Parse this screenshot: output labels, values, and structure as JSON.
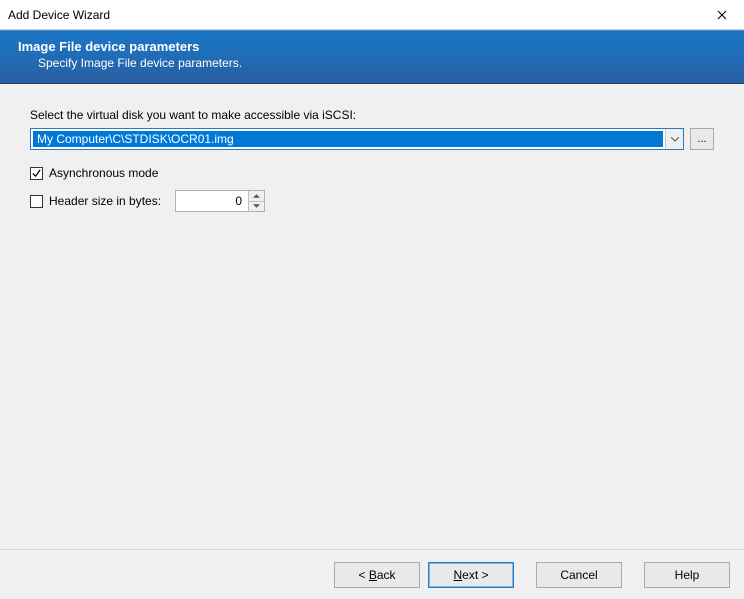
{
  "window": {
    "title": "Add Device Wizard"
  },
  "banner": {
    "heading": "Image File device parameters",
    "subheading": "Specify Image File device parameters."
  },
  "main": {
    "select_label": "Select the virtual disk you want to make accessible via iSCSI:",
    "disk_path": "My Computer\\C\\STDISK\\OCR01.img",
    "browse_label": "...",
    "async_checked": true,
    "async_label": "Asynchronous mode",
    "header_checked": false,
    "header_label": "Header size in bytes:",
    "header_value": "0"
  },
  "footer": {
    "back_pre": "< ",
    "back_u": "B",
    "back_post": "ack",
    "next_u": "N",
    "next_post": "ext >",
    "cancel": "Cancel",
    "help": "Help"
  }
}
